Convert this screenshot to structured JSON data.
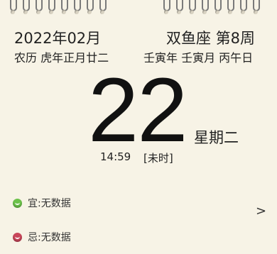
{
  "date": {
    "year_month": "2022年02月",
    "constellation_week": "双鱼座 第8周",
    "lunar": "农历 虎年正月廿二",
    "ganzhi": "壬寅年 壬寅月 丙午日",
    "day": "22",
    "weekday": "星期二",
    "time": "14:59",
    "shichen": "[未时]"
  },
  "almanac": {
    "yi_label": "宜:无数据",
    "ji_label": "忌:无数据",
    "yi_icon": "green-smile-icon",
    "ji_icon": "red-frown-icon",
    "more_icon": "chevron-right-icon",
    "more_glyph": ">"
  },
  "colors": {
    "background": "#f7f3e6",
    "yi_dot": "#6cc24a",
    "ji_dot": "#c9465a"
  }
}
